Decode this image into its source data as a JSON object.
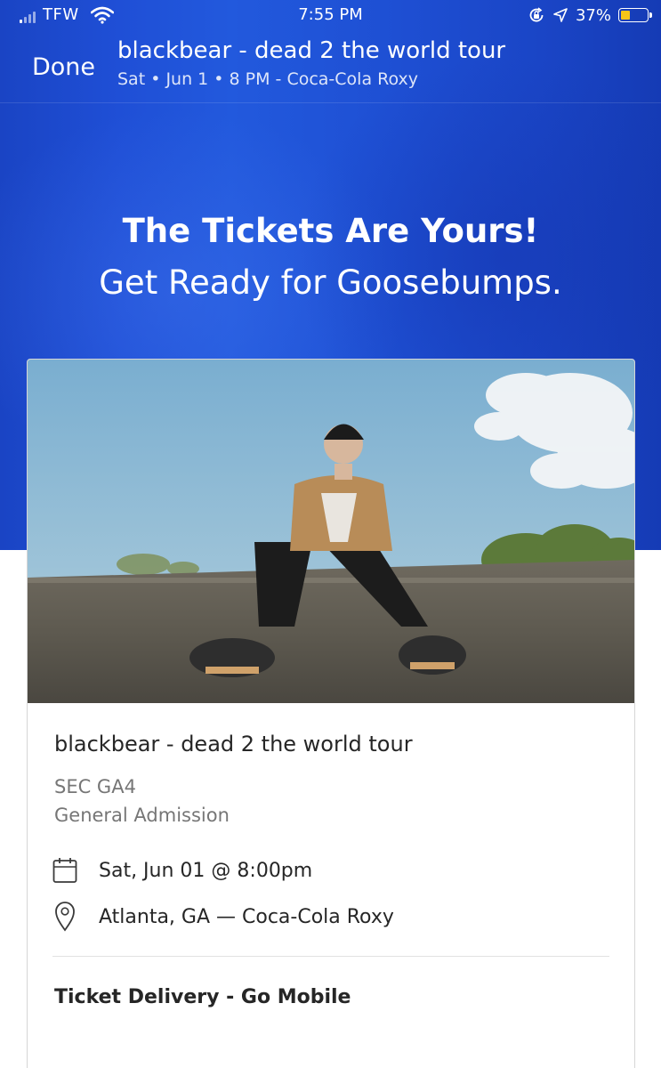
{
  "status_bar": {
    "carrier": "TFW",
    "time": "7:55 PM",
    "battery_percent": "37%",
    "battery_level": 0.37,
    "battery_color": "#f5c518",
    "icons": [
      "signal-icon",
      "wifi-icon",
      "rotation-lock-icon",
      "location-arrow-icon",
      "battery-icon"
    ]
  },
  "header": {
    "done_label": "Done",
    "title": "blackbear - dead 2 the world tour",
    "subtitle": "Sat • Jun 1 • 8 PM - Coca-Cola Roxy"
  },
  "hero": {
    "headline": "The Tickets Are Yours!",
    "subheadline": "Get Ready for Goosebumps.",
    "background_color": "#1f4fd6"
  },
  "ticket": {
    "event_title": "blackbear - dead 2 the world tour",
    "section": "SEC GA4",
    "admission": "General Admission",
    "date_time": "Sat, Jun 01 @ 8:00pm",
    "venue": "Atlanta, GA — Coca-Cola Roxy",
    "delivery": "Ticket Delivery - Go Mobile",
    "icons": [
      "calendar-icon",
      "location-pin-icon"
    ]
  }
}
